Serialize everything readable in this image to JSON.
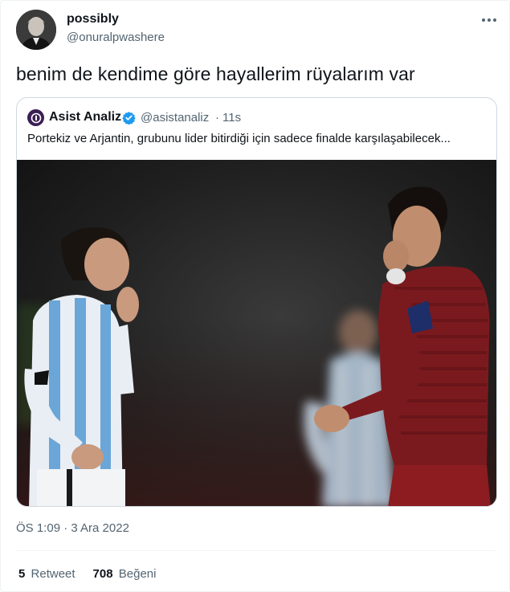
{
  "author": {
    "display_name": "possibly",
    "handle": "@onuralpwashere"
  },
  "tweet": {
    "text": "benim de kendime göre hayallerim rüyalarım var",
    "timestamp": "ÖS 1:09 · 3 Ara 2022"
  },
  "quoted_tweet": {
    "display_name": "Asist Analiz",
    "handle": "@asistanaliz",
    "separator": "·",
    "time": "11s",
    "text": "Portekiz ve Arjantin, grubunu lider bitirdiği için sadece finalde karşılaşabilecek..."
  },
  "stats": {
    "retweets_count": "5",
    "retweets_label": "Retweet",
    "likes_count": "708",
    "likes_label": "Beğeni"
  },
  "colors": {
    "text_primary": "#0f1419",
    "text_secondary": "#536471",
    "border": "#cfd9de",
    "verified": "#1d9bf0"
  },
  "icons": {
    "more": "more-horizontal-icon",
    "verified": "verified-badge-icon"
  }
}
